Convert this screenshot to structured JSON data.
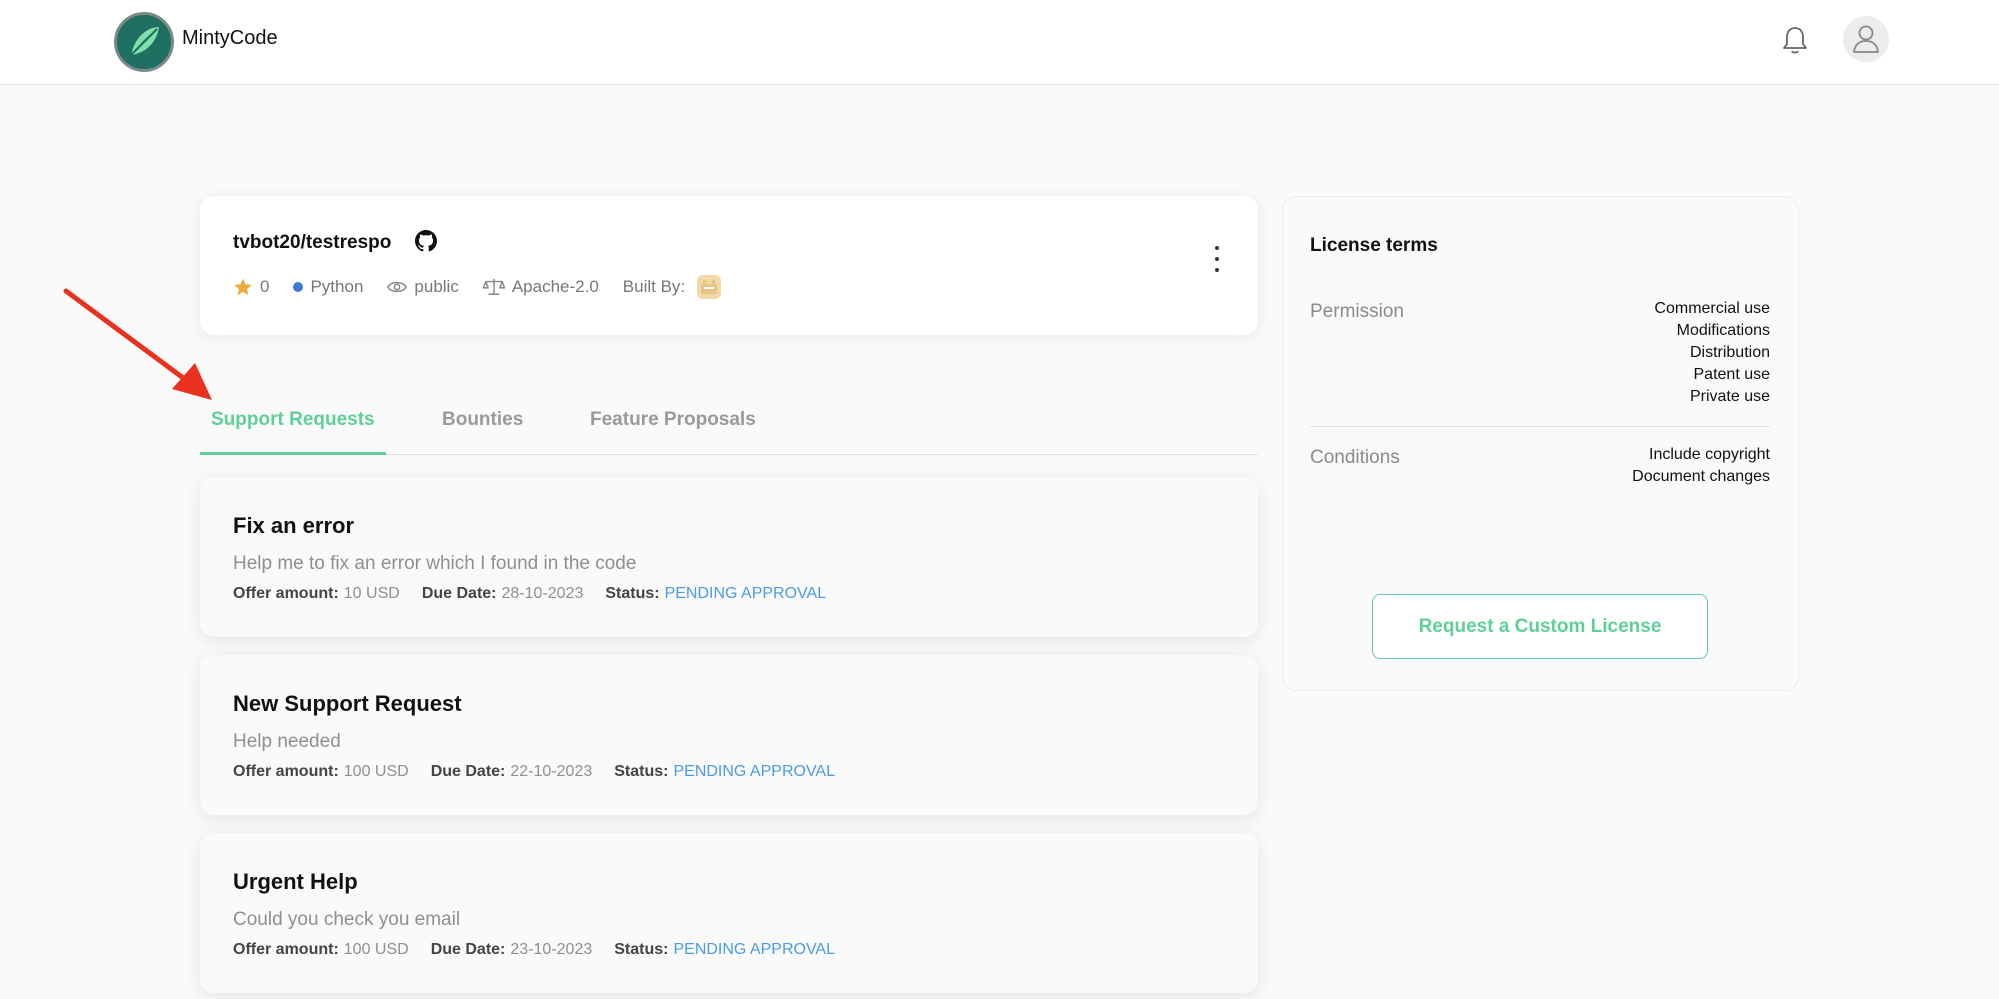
{
  "header": {
    "brand": "MintyCode"
  },
  "repo": {
    "name": "tvbot20/testrespo",
    "stars": "0",
    "language": "Python",
    "language_color": "#3b7bd4",
    "visibility": "public",
    "license": "Apache-2.0",
    "built_by_label": "Built By:"
  },
  "tabs": [
    {
      "label": "Support Requests",
      "active": true
    },
    {
      "label": "Bounties",
      "active": false
    },
    {
      "label": "Feature Proposals",
      "active": false
    }
  ],
  "requests": [
    {
      "title": "Fix an error",
      "description": "Help me to fix an error which I found in the code",
      "offer_label": "Offer amount:",
      "offer": "10 USD",
      "due_label": "Due Date:",
      "due": "28-10-2023",
      "status_label": "Status:",
      "status": "PENDING APPROVAL"
    },
    {
      "title": "New Support Request",
      "description": "Help needed",
      "offer_label": "Offer amount:",
      "offer": "100 USD",
      "due_label": "Due Date:",
      "due": "22-10-2023",
      "status_label": "Status:",
      "status": "PENDING APPROVAL"
    },
    {
      "title": "Urgent Help",
      "description": "Could you check you email",
      "offer_label": "Offer amount:",
      "offer": "100 USD",
      "due_label": "Due Date:",
      "due": "23-10-2023",
      "status_label": "Status:",
      "status": "PENDING APPROVAL"
    }
  ],
  "license": {
    "title": "License terms",
    "permission_label": "Permission",
    "permissions": [
      "Commercial use",
      "Modifications",
      "Distribution",
      "Patent use",
      "Private use"
    ],
    "conditions_label": "Conditions",
    "conditions": [
      "Include copyright",
      "Document changes"
    ],
    "button_label": "Request a Custom License"
  },
  "colors": {
    "accent": "#5fcf98",
    "status": "#4a9be6",
    "annotation_arrow": "#e8321f"
  }
}
